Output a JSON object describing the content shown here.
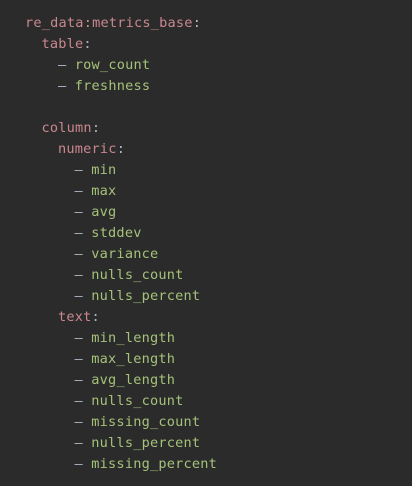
{
  "colors": {
    "background": "#2b2b2b",
    "key": "#c9888f",
    "punctuation": "#a9b7c6",
    "value": "#a5c27a"
  },
  "lines": [
    {
      "indent": 0,
      "kind": "key",
      "text": "re_data:metrics_base",
      "suffix": ":"
    },
    {
      "indent": 1,
      "kind": "key",
      "text": "table",
      "suffix": ":"
    },
    {
      "indent": 2,
      "kind": "item",
      "dash": "–",
      "text": "row_count"
    },
    {
      "indent": 2,
      "kind": "item",
      "dash": "–",
      "text": "freshness"
    },
    {
      "indent": 0,
      "kind": "blank",
      "text": ""
    },
    {
      "indent": 1,
      "kind": "key",
      "text": "column",
      "suffix": ":"
    },
    {
      "indent": 2,
      "kind": "key",
      "text": "numeric",
      "suffix": ":"
    },
    {
      "indent": 3,
      "kind": "item",
      "dash": "–",
      "text": "min"
    },
    {
      "indent": 3,
      "kind": "item",
      "dash": "–",
      "text": "max"
    },
    {
      "indent": 3,
      "kind": "item",
      "dash": "–",
      "text": "avg"
    },
    {
      "indent": 3,
      "kind": "item",
      "dash": "–",
      "text": "stddev"
    },
    {
      "indent": 3,
      "kind": "item",
      "dash": "–",
      "text": "variance"
    },
    {
      "indent": 3,
      "kind": "item",
      "dash": "–",
      "text": "nulls_count"
    },
    {
      "indent": 3,
      "kind": "item",
      "dash": "–",
      "text": "nulls_percent"
    },
    {
      "indent": 2,
      "kind": "key",
      "text": "text",
      "suffix": ":"
    },
    {
      "indent": 3,
      "kind": "item",
      "dash": "–",
      "text": "min_length"
    },
    {
      "indent": 3,
      "kind": "item",
      "dash": "–",
      "text": "max_length"
    },
    {
      "indent": 3,
      "kind": "item",
      "dash": "–",
      "text": "avg_length"
    },
    {
      "indent": 3,
      "kind": "item",
      "dash": "–",
      "text": "nulls_count"
    },
    {
      "indent": 3,
      "kind": "item",
      "dash": "–",
      "text": "missing_count"
    },
    {
      "indent": 3,
      "kind": "item",
      "dash": "–",
      "text": "nulls_percent"
    },
    {
      "indent": 3,
      "kind": "item",
      "dash": "–",
      "text": "missing_percent"
    }
  ]
}
